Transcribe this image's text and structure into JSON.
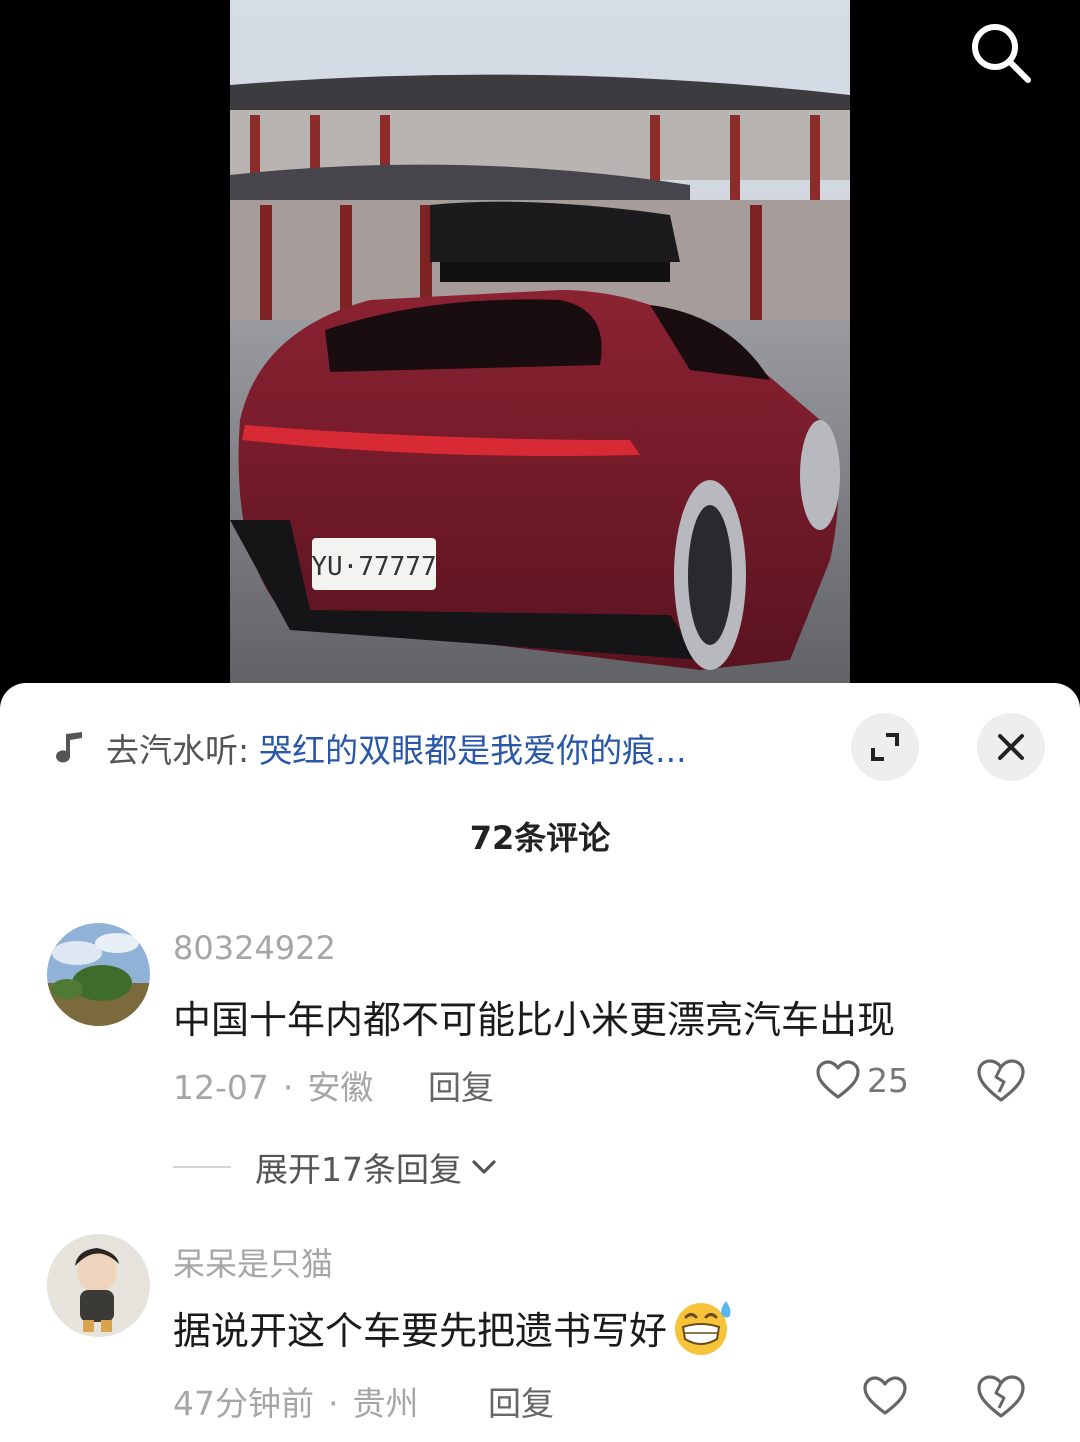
{
  "music": {
    "prefix": "去汽水听:",
    "title": "哭红的双眼都是我爱你的痕..."
  },
  "comments_header": {
    "count_label": "72条评论"
  },
  "comments": [
    {
      "username": "80324922",
      "text": "中国十年内都不可能比小米更漂亮汽车出现",
      "date": "12-07",
      "location": "安徽",
      "reply_label": "回复",
      "like_count": "25",
      "expand_label": "展开17条回复"
    },
    {
      "username": "呆呆是只猫",
      "text": "据说开这个车要先把遗书写好",
      "date": "47分钟前",
      "location": "贵州",
      "reply_label": "回复"
    }
  ],
  "plate_text": "YU·77777",
  "icons": {
    "search": "search-icon",
    "music": "music-note-icon",
    "expand": "expand-icon",
    "close": "close-icon",
    "like": "heart-icon",
    "dislike": "broken-heart-icon",
    "chevron": "chevron-down-icon",
    "emoji": "grinning-sweat-emoji"
  },
  "colors": {
    "sheet_bg": "#ffffff",
    "link_blue": "#2a57a8",
    "muted": "#a6a6a6",
    "car_red": "#7a1a26"
  }
}
